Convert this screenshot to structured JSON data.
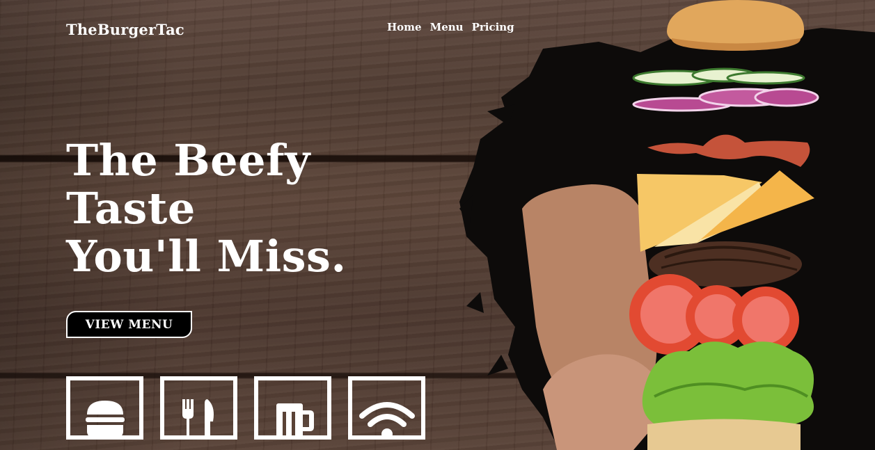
{
  "nav": {
    "logo": "TheBurgerTac",
    "items": [
      {
        "label": "Home"
      },
      {
        "label": "Menu"
      },
      {
        "label": "Pricing"
      }
    ]
  },
  "hero": {
    "headline_lines": [
      "The Beefy",
      "Taste",
      "You'll Miss."
    ],
    "cta_label": "VIEW MENU"
  },
  "features": [
    {
      "icon": "burger-icon"
    },
    {
      "icon": "fork-knife-icon"
    },
    {
      "icon": "beer-mug-icon"
    },
    {
      "icon": "wifi-icon"
    }
  ],
  "colors": {
    "text": "#ffffff",
    "cta_bg": "#000000",
    "wood": "#56403a"
  }
}
